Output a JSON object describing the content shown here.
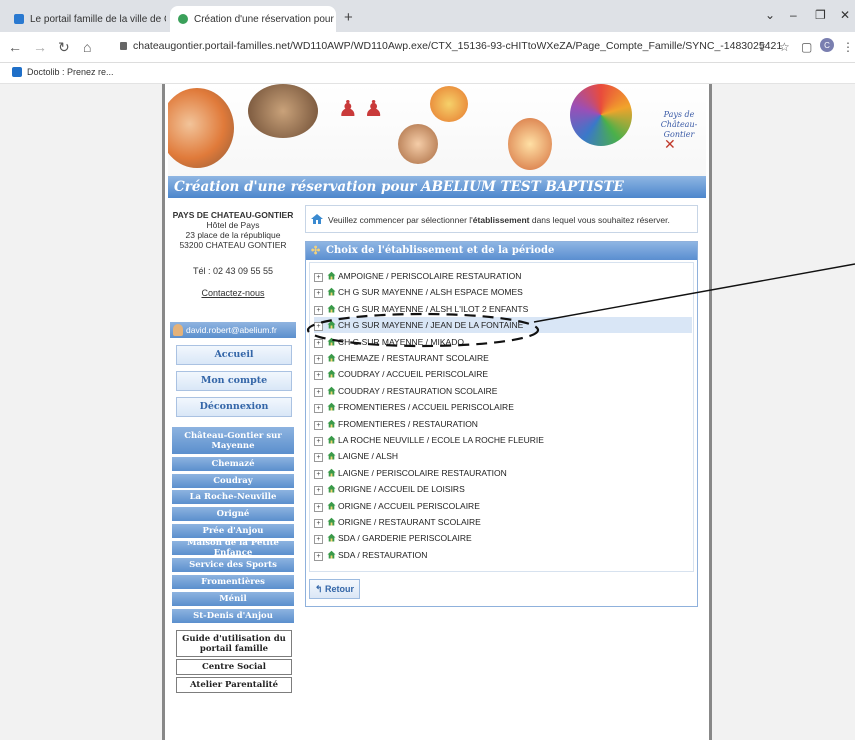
{
  "browser": {
    "tabs": [
      {
        "title": "Le portail famille de la ville de Ch"
      },
      {
        "title": "Création d'une réservation pour"
      }
    ],
    "url": "chateaugontier.portail-familles.net/WD110AWP/WD110Awp.exe/CTX_15136-93-cHITtoWXeZA/Page_Compte_Famille/SYNC_-1483025421",
    "bookmark": "Doctolib : Prenez re...",
    "profile_initial": "C"
  },
  "page": {
    "title": "Création d'une réservation pour ABELIUM TEST BAPTISTE",
    "logo_text": "Pays de Château-Gontier"
  },
  "sidebar": {
    "org_name": "PAYS DE CHATEAU-GONTIER",
    "address1": "Hôtel de Pays",
    "address2": "23 place de la république",
    "address3": "53200 CHATEAU GONTIER",
    "phone": "Tél : 02 43 09 55 55",
    "contact": "Contactez-nous",
    "user_email": "david.robert@abelium.fr",
    "nav": [
      "Accueil",
      "Mon compte",
      "Déconnexion"
    ],
    "towns": [
      "Château-Gontier sur Mayenne",
      "Chemazé",
      "Coudray",
      "La Roche-Neuville",
      "Origné",
      "Prée d'Anjou",
      "Maison de la Petite Enfance",
      "Service des Sports",
      "Fromentières",
      "Ménil",
      "St-Denis d'Anjou"
    ],
    "extras": [
      "Guide d'utilisation du portail famille",
      "Centre Social",
      "Atelier Parentalité"
    ]
  },
  "main": {
    "info_pre": "Veuillez commencer par sélectionner l'",
    "info_bold": "établissement",
    "info_post": " dans lequel vous souhaitez réserver.",
    "panel_title": "Choix de l'établissement et de la période",
    "items": [
      "AMPOIGNE / PERISCOLAIRE RESTAURATION",
      "CH G SUR MAYENNE / ALSH ESPACE MOMES",
      "CH G SUR MAYENNE / ALSH L'ILOT 2 ENFANTS",
      "CH G SUR MAYENNE / JEAN DE LA FONTAINE",
      "CH G SUR MAYENNE / MIKADO",
      "CHEMAZE / RESTAURANT SCOLAIRE",
      "COUDRAY / ACCUEIL PERISCOLAIRE",
      "COUDRAY / RESTAURATION SCOLAIRE",
      "FROMENTIERES / ACCUEIL PERISCOLAIRE",
      "FROMENTIERES / RESTAURATION",
      "LA ROCHE NEUVILLE / ECOLE LA ROCHE FLEURIE",
      "LAIGNE / ALSH",
      "LAIGNE / PERISCOLAIRE RESTAURATION",
      "ORIGNE / ACCUEIL DE LOISIRS",
      "ORIGNE / ACCUEIL PERISCOLAIRE",
      "ORIGNE / RESTAURANT SCOLAIRE",
      "SDA / GARDERIE PERISCOLAIRE",
      "SDA / RESTAURATION"
    ],
    "selected_index": 3,
    "back_label": "Retour"
  },
  "colors": {
    "accent": "#4c86cc",
    "link": "#3466a8"
  }
}
